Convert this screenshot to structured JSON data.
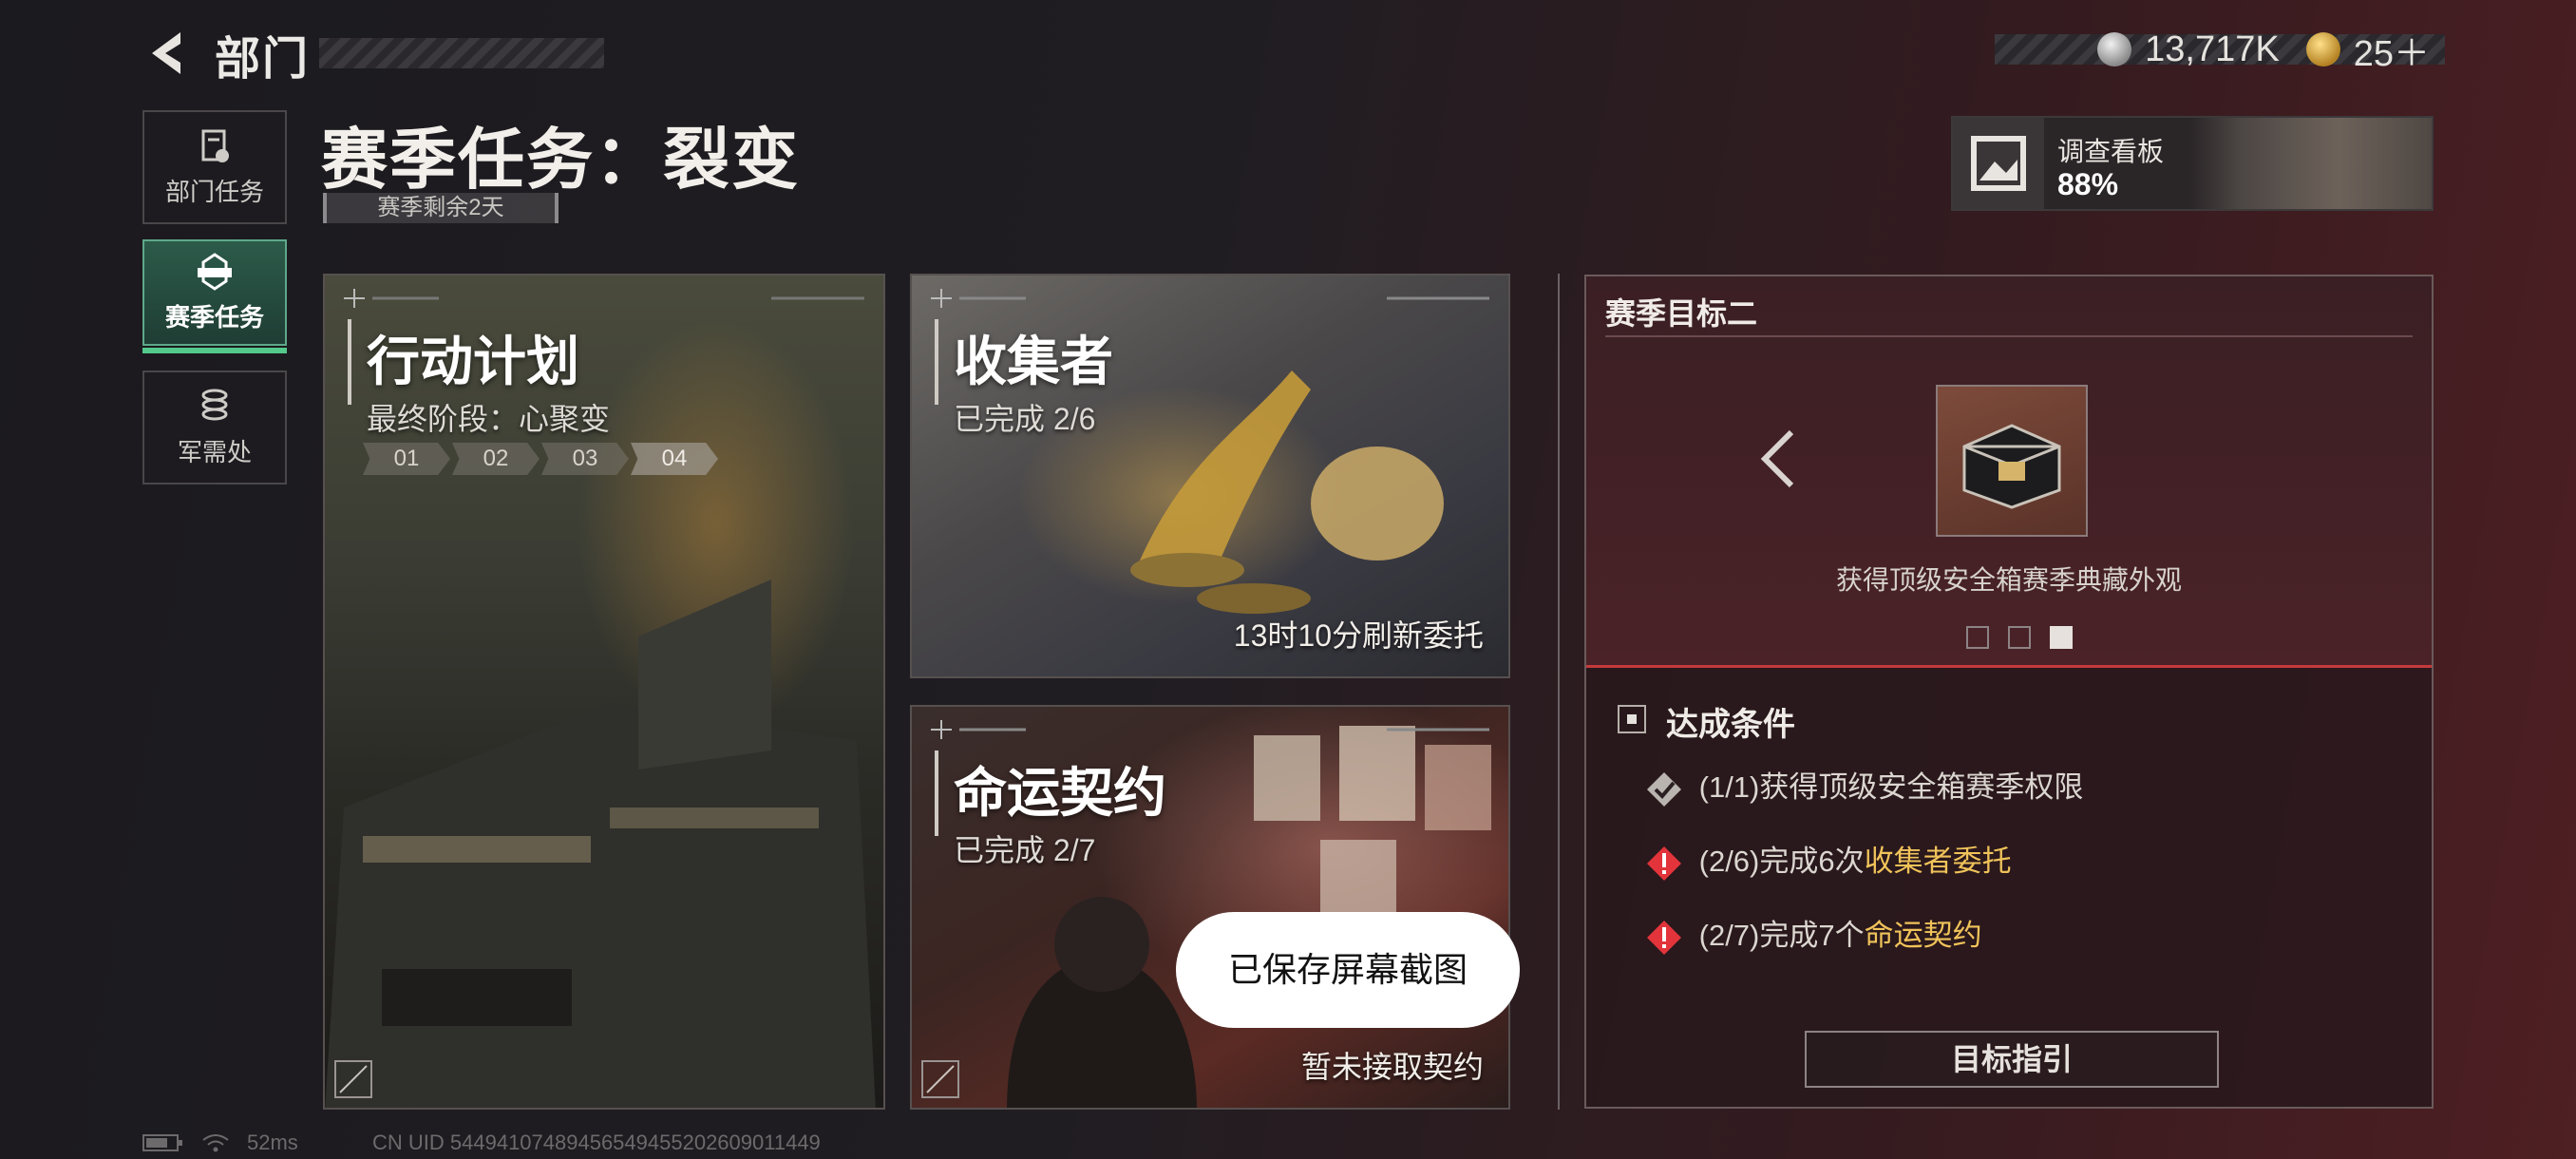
{
  "header": {
    "title": "部门",
    "currency_silver": "13,717K",
    "currency_gold": "25＋",
    "colors": {
      "accent_green": "#53c98c",
      "accent_red": "#c43a3c",
      "highlight_gold": "#f0c35a"
    }
  },
  "sidebar": {
    "items": [
      {
        "label": "部门任务",
        "icon": "document-icon"
      },
      {
        "label": "赛季任务",
        "icon": "briefcase-icon",
        "active": true
      },
      {
        "label": "军需处",
        "icon": "coins-icon"
      }
    ]
  },
  "main": {
    "title": "赛季任务：裂变",
    "season_left": "赛季剩余2天",
    "board": {
      "name": "调查看板",
      "percent": "88%"
    },
    "cards": [
      {
        "name": "行动计划",
        "sub": "最终阶段：心聚变",
        "stages": [
          "01",
          "02",
          "03",
          "04"
        ]
      },
      {
        "name": "收集者",
        "sub": "已完成 2/6",
        "footer": "13时10分刷新委托"
      },
      {
        "name": "命运契约",
        "sub": "已完成 2/7",
        "footer": "暂未接取契约"
      }
    ]
  },
  "panel": {
    "title": "赛季目标二",
    "reward_caption": "获得顶级安全箱赛季典藏外观",
    "conditions_title": "达成条件",
    "conditions": [
      {
        "prefix": "(1/1)获得顶级安全箱赛季权限",
        "highlight": "",
        "status": "done"
      },
      {
        "prefix": "(2/6)完成6次",
        "highlight": "收集者委托",
        "status": "alert"
      },
      {
        "prefix": "(2/7)完成7个",
        "highlight": "命运契约",
        "status": "alert"
      }
    ],
    "guide_button": "目标指引"
  },
  "toast": "已保存屏幕截图",
  "status_bar": {
    "latency": "52ms",
    "uid": "CN UID 5449410748945654945520260901144​9"
  }
}
